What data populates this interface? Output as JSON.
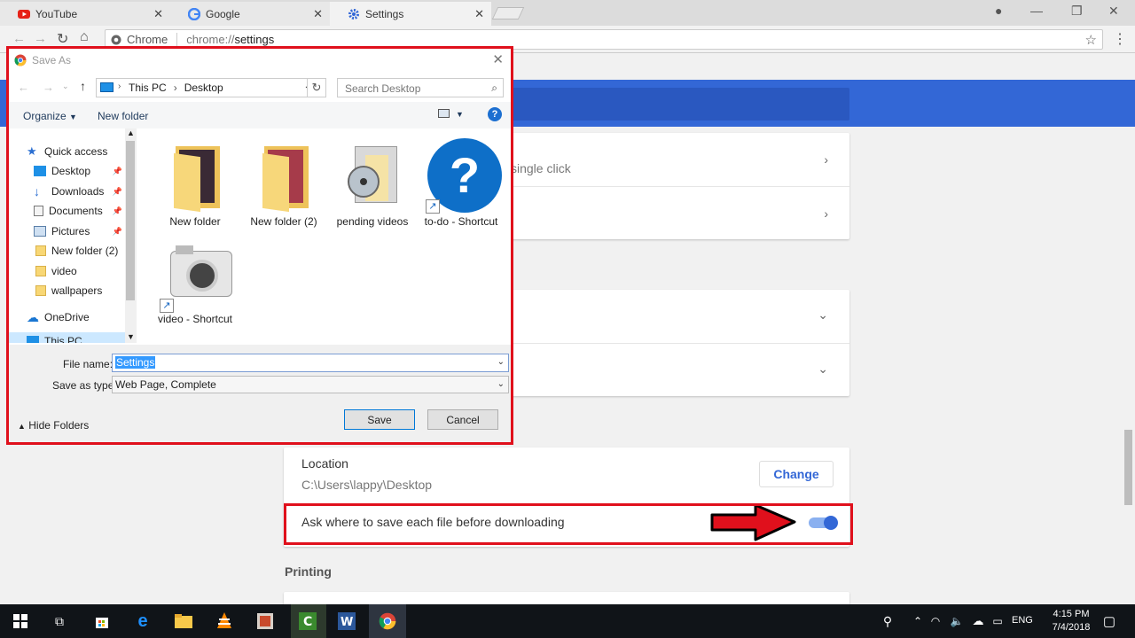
{
  "browser": {
    "tabs": [
      {
        "label": "YouTube"
      },
      {
        "label": "Google"
      },
      {
        "label": "Settings"
      }
    ],
    "omnibox": {
      "chip": "Chrome",
      "url_scheme": "chrome://",
      "url_host": "settings"
    }
  },
  "settings": {
    "row_single_click": "single click",
    "download_location_label": "Location",
    "download_location_path": "C:\\Users\\lappy\\Desktop",
    "change_button": "Change",
    "ask_where_label": "Ask where to save each file before downloading",
    "ask_where_enabled": true,
    "printing_heading": "Printing"
  },
  "dialog": {
    "title": "Save As",
    "breadcrumb": [
      "This PC",
      "Desktop"
    ],
    "search_placeholder": "Search Desktop",
    "organize": "Organize",
    "new_folder": "New folder",
    "nav_items": [
      {
        "label": "Quick access",
        "icon": "star-icon"
      },
      {
        "label": "Desktop",
        "icon": "desktop-icon",
        "pinned": true
      },
      {
        "label": "Downloads",
        "icon": "download-icon",
        "pinned": true
      },
      {
        "label": "Documents",
        "icon": "documents-icon",
        "pinned": true
      },
      {
        "label": "Pictures",
        "icon": "pictures-icon",
        "pinned": true
      },
      {
        "label": "New folder (2)",
        "icon": "folder-icon"
      },
      {
        "label": "video",
        "icon": "folder-icon"
      },
      {
        "label": "wallpapers",
        "icon": "folder-icon"
      },
      {
        "label": "OneDrive",
        "icon": "cloud-icon"
      },
      {
        "label": "This PC",
        "icon": "pc-icon"
      }
    ],
    "files": [
      {
        "label": "New folder",
        "icon": "folder-icon"
      },
      {
        "label": "New folder (2)",
        "icon": "folder-icon"
      },
      {
        "label": "pending videos",
        "icon": "media-folder-icon"
      },
      {
        "label": "to-do - Shortcut",
        "icon": "help-shortcut-icon"
      },
      {
        "label": "video - Shortcut",
        "icon": "camera-shortcut-icon"
      }
    ],
    "file_name_label": "File name:",
    "file_name_value": "Settings",
    "save_type_label": "Save as type:",
    "save_type_value": "Web Page, Complete",
    "hide_folders": "Hide Folders",
    "save_button": "Save",
    "cancel_button": "Cancel"
  },
  "taskbar": {
    "language": "ENG",
    "time": "4:15 PM",
    "date": "7/4/2018"
  },
  "colors": {
    "highlight_red": "#e0101c",
    "settings_blue": "#3367d6",
    "taskbar": "#101418"
  }
}
